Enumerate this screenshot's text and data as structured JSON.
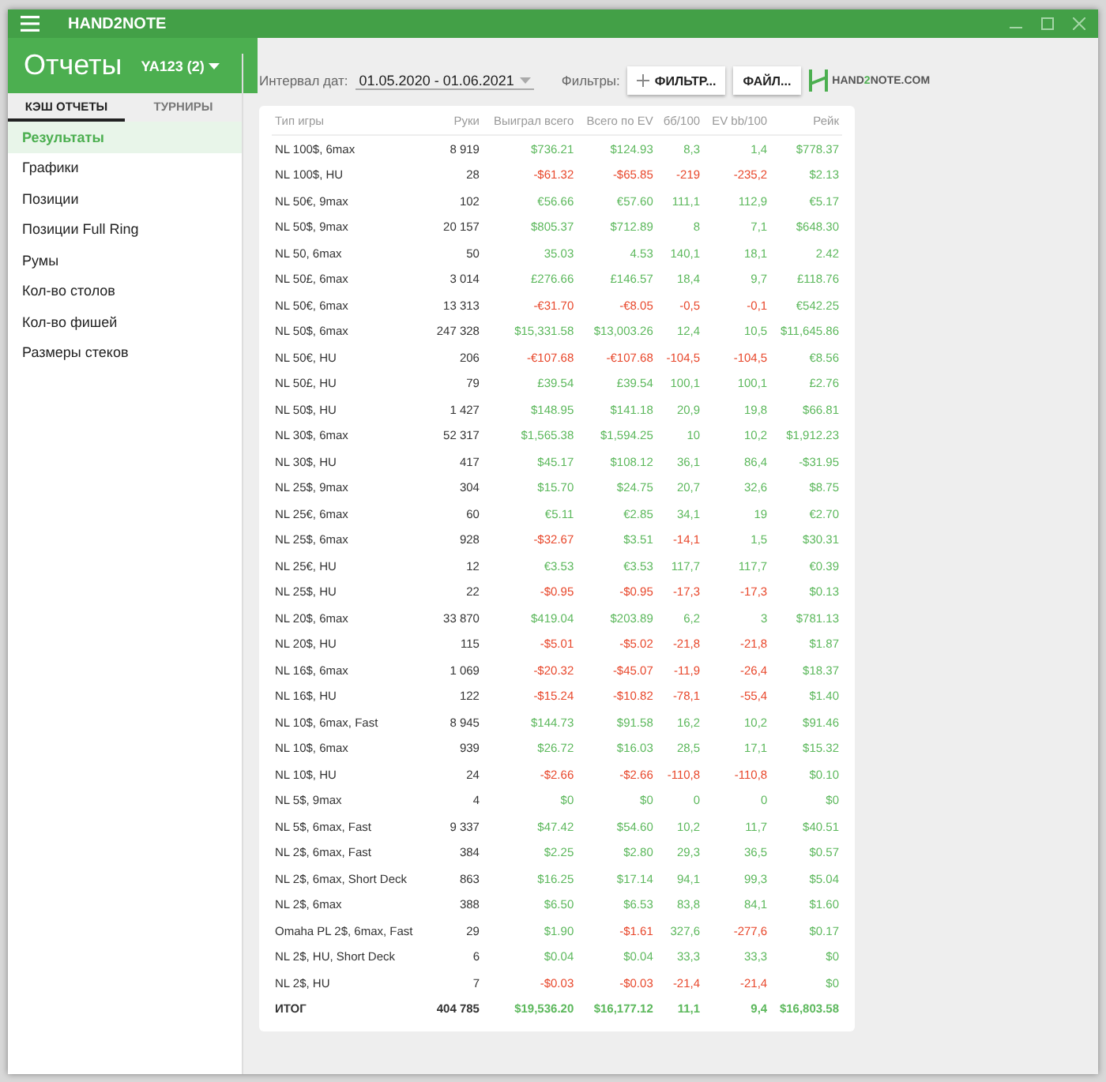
{
  "window": {
    "title": "HAND2NOTE"
  },
  "header": {
    "title": "Отчеты",
    "player": "YA123 (2)"
  },
  "tabs": [
    {
      "label": "КЭШ ОТЧЕТЫ",
      "selected": true
    },
    {
      "label": "ТУРНИРЫ",
      "selected": false
    }
  ],
  "sidebar": {
    "items": [
      {
        "label": "Результаты",
        "selected": true
      },
      {
        "label": "Графики",
        "selected": false
      },
      {
        "label": "Позиции",
        "selected": false
      },
      {
        "label": "Позиции Full Ring",
        "selected": false
      },
      {
        "label": "Румы",
        "selected": false
      },
      {
        "label": "Кол-во столов",
        "selected": false
      },
      {
        "label": "Кол-во фишей",
        "selected": false
      },
      {
        "label": "Размеры стеков",
        "selected": false
      }
    ]
  },
  "toolbar": {
    "date_label": "Интервал дат:",
    "date_range": "01.05.2020 - 01.06.2021",
    "filters_label": "Фильтры:",
    "filter_button": "ФИЛЬТР...",
    "file_button": "ФАЙЛ...",
    "logo": {
      "before": "HAND",
      "accent": "2",
      "after": "NOTE.COM"
    }
  },
  "table": {
    "columns": [
      "Тип игры",
      "Руки",
      "Выиграл всего",
      "Всего по EV",
      "бб/100",
      "EV bb/100",
      "Рейк"
    ],
    "rows": [
      {
        "game": "NL 100$, 6max",
        "hands": "8 919",
        "values": [
          "$736.21",
          "$124.93",
          "8,3",
          "1,4",
          "$778.37"
        ],
        "loss": [
          false,
          false,
          false,
          false,
          false
        ]
      },
      {
        "game": "NL 100$, HU",
        "hands": "28",
        "values": [
          "-$61.32",
          "-$65.85",
          "-219",
          "-235,2",
          "$2.13"
        ],
        "loss": [
          true,
          true,
          true,
          true,
          false
        ]
      },
      {
        "game": "NL 50€, 9max",
        "hands": "102",
        "values": [
          "€56.66",
          "€57.60",
          "111,1",
          "112,9",
          "€5.17"
        ],
        "loss": [
          false,
          false,
          false,
          false,
          false
        ]
      },
      {
        "game": "NL 50$, 9max",
        "hands": "20 157",
        "values": [
          "$805.37",
          "$712.89",
          "8",
          "7,1",
          "$648.30"
        ],
        "loss": [
          false,
          false,
          false,
          false,
          false
        ]
      },
      {
        "game": "NL 50, 6max",
        "hands": "50",
        "values": [
          "35.03",
          "4.53",
          "140,1",
          "18,1",
          "2.42"
        ],
        "loss": [
          false,
          false,
          false,
          false,
          false
        ]
      },
      {
        "game": "NL 50£, 6max",
        "hands": "3 014",
        "values": [
          "£276.66",
          "£146.57",
          "18,4",
          "9,7",
          "£118.76"
        ],
        "loss": [
          false,
          false,
          false,
          false,
          false
        ]
      },
      {
        "game": "NL 50€, 6max",
        "hands": "13 313",
        "values": [
          "-€31.70",
          "-€8.05",
          "-0,5",
          "-0,1",
          "€542.25"
        ],
        "loss": [
          true,
          true,
          true,
          true,
          false
        ]
      },
      {
        "game": "NL 50$, 6max",
        "hands": "247 328",
        "values": [
          "$15,331.58",
          "$13,003.26",
          "12,4",
          "10,5",
          "$11,645.86"
        ],
        "loss": [
          false,
          false,
          false,
          false,
          false
        ]
      },
      {
        "game": "NL 50€, HU",
        "hands": "206",
        "values": [
          "-€107.68",
          "-€107.68",
          "-104,5",
          "-104,5",
          "€8.56"
        ],
        "loss": [
          true,
          true,
          true,
          true,
          false
        ]
      },
      {
        "game": "NL 50£, HU",
        "hands": "79",
        "values": [
          "£39.54",
          "£39.54",
          "100,1",
          "100,1",
          "£2.76"
        ],
        "loss": [
          false,
          false,
          false,
          false,
          false
        ]
      },
      {
        "game": "NL 50$, HU",
        "hands": "1 427",
        "values": [
          "$148.95",
          "$141.18",
          "20,9",
          "19,8",
          "$66.81"
        ],
        "loss": [
          false,
          false,
          false,
          false,
          false
        ]
      },
      {
        "game": "NL 30$, 6max",
        "hands": "52 317",
        "values": [
          "$1,565.38",
          "$1,594.25",
          "10",
          "10,2",
          "$1,912.23"
        ],
        "loss": [
          false,
          false,
          false,
          false,
          false
        ]
      },
      {
        "game": "NL 30$, HU",
        "hands": "417",
        "values": [
          "$45.17",
          "$108.12",
          "36,1",
          "86,4",
          "-$31.95"
        ],
        "loss": [
          false,
          false,
          false,
          false,
          false
        ]
      },
      {
        "game": "NL 25$, 9max",
        "hands": "304",
        "values": [
          "$15.70",
          "$24.75",
          "20,7",
          "32,6",
          "$8.75"
        ],
        "loss": [
          false,
          false,
          false,
          false,
          false
        ]
      },
      {
        "game": "NL 25€, 6max",
        "hands": "60",
        "values": [
          "€5.11",
          "€2.85",
          "34,1",
          "19",
          "€2.70"
        ],
        "loss": [
          false,
          false,
          false,
          false,
          false
        ]
      },
      {
        "game": "NL 25$, 6max",
        "hands": "928",
        "values": [
          "-$32.67",
          "$3.51",
          "-14,1",
          "1,5",
          "$30.31"
        ],
        "loss": [
          true,
          false,
          true,
          false,
          false
        ]
      },
      {
        "game": "NL 25€, HU",
        "hands": "12",
        "values": [
          "€3.53",
          "€3.53",
          "117,7",
          "117,7",
          "€0.39"
        ],
        "loss": [
          false,
          false,
          false,
          false,
          false
        ]
      },
      {
        "game": "NL 25$, HU",
        "hands": "22",
        "values": [
          "-$0.95",
          "-$0.95",
          "-17,3",
          "-17,3",
          "$0.13"
        ],
        "loss": [
          true,
          true,
          true,
          true,
          false
        ]
      },
      {
        "game": "NL 20$, 6max",
        "hands": "33 870",
        "values": [
          "$419.04",
          "$203.89",
          "6,2",
          "3",
          "$781.13"
        ],
        "loss": [
          false,
          false,
          false,
          false,
          false
        ]
      },
      {
        "game": "NL 20$, HU",
        "hands": "115",
        "values": [
          "-$5.01",
          "-$5.02",
          "-21,8",
          "-21,8",
          "$1.87"
        ],
        "loss": [
          true,
          true,
          true,
          true,
          false
        ]
      },
      {
        "game": "NL 16$, 6max",
        "hands": "1 069",
        "values": [
          "-$20.32",
          "-$45.07",
          "-11,9",
          "-26,4",
          "$18.37"
        ],
        "loss": [
          true,
          true,
          true,
          true,
          false
        ]
      },
      {
        "game": "NL 16$, HU",
        "hands": "122",
        "values": [
          "-$15.24",
          "-$10.82",
          "-78,1",
          "-55,4",
          "$1.40"
        ],
        "loss": [
          true,
          true,
          true,
          true,
          false
        ]
      },
      {
        "game": "NL 10$, 6max, Fast",
        "hands": "8 945",
        "values": [
          "$144.73",
          "$91.58",
          "16,2",
          "10,2",
          "$91.46"
        ],
        "loss": [
          false,
          false,
          false,
          false,
          false
        ]
      },
      {
        "game": "NL 10$, 6max",
        "hands": "939",
        "values": [
          "$26.72",
          "$16.03",
          "28,5",
          "17,1",
          "$15.32"
        ],
        "loss": [
          false,
          false,
          false,
          false,
          false
        ]
      },
      {
        "game": "NL 10$, HU",
        "hands": "24",
        "values": [
          "-$2.66",
          "-$2.66",
          "-110,8",
          "-110,8",
          "$0.10"
        ],
        "loss": [
          true,
          true,
          true,
          true,
          false
        ]
      },
      {
        "game": "NL 5$, 9max",
        "hands": "4",
        "values": [
          "$0",
          "$0",
          "0",
          "0",
          "$0"
        ],
        "loss": [
          false,
          false,
          false,
          false,
          false
        ]
      },
      {
        "game": "NL 5$, 6max, Fast",
        "hands": "9 337",
        "values": [
          "$47.42",
          "$54.60",
          "10,2",
          "11,7",
          "$40.51"
        ],
        "loss": [
          false,
          false,
          false,
          false,
          false
        ]
      },
      {
        "game": "NL 2$, 6max, Fast",
        "hands": "384",
        "values": [
          "$2.25",
          "$2.80",
          "29,3",
          "36,5",
          "$0.57"
        ],
        "loss": [
          false,
          false,
          false,
          false,
          false
        ]
      },
      {
        "game": "NL 2$, 6max, Short Deck",
        "hands": "863",
        "values": [
          "$16.25",
          "$17.14",
          "94,1",
          "99,3",
          "$5.04"
        ],
        "loss": [
          false,
          false,
          false,
          false,
          false
        ]
      },
      {
        "game": "NL 2$, 6max",
        "hands": "388",
        "values": [
          "$6.50",
          "$6.53",
          "83,8",
          "84,1",
          "$1.60"
        ],
        "loss": [
          false,
          false,
          false,
          false,
          false
        ]
      },
      {
        "game": "Omaha PL 2$, 6max, Fast",
        "hands": "29",
        "values": [
          "$1.90",
          "-$1.61",
          "327,6",
          "-277,6",
          "$0.17"
        ],
        "loss": [
          false,
          true,
          false,
          true,
          false
        ]
      },
      {
        "game": "NL 2$, HU, Short Deck",
        "hands": "6",
        "values": [
          "$0.04",
          "$0.04",
          "33,3",
          "33,3",
          "$0"
        ],
        "loss": [
          false,
          false,
          false,
          false,
          false
        ]
      },
      {
        "game": "NL 2$, HU",
        "hands": "7",
        "values": [
          "-$0.03",
          "-$0.03",
          "-21,4",
          "-21,4",
          "$0"
        ],
        "loss": [
          true,
          true,
          true,
          true,
          false
        ]
      }
    ],
    "total": {
      "game": "ИТОГ",
      "hands": "404 785",
      "values": [
        "$19,536.20",
        "$16,177.12",
        "11,1",
        "9,4",
        "$16,803.58"
      ],
      "loss": [
        false,
        false,
        false,
        false,
        false
      ]
    }
  }
}
